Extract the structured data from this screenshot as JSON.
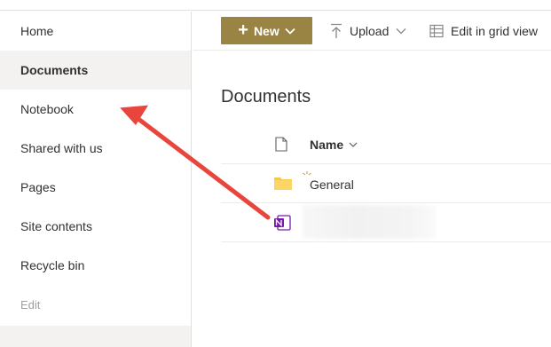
{
  "sidebar": {
    "items": [
      {
        "label": "Home"
      },
      {
        "label": "Documents"
      },
      {
        "label": "Notebook"
      },
      {
        "label": "Shared with us"
      },
      {
        "label": "Pages"
      },
      {
        "label": "Site contents"
      },
      {
        "label": "Recycle bin"
      },
      {
        "label": "Edit"
      }
    ],
    "selected": "Documents"
  },
  "toolbar": {
    "new_label": "New",
    "upload_label": "Upload",
    "grid_label": "Edit in grid view"
  },
  "main": {
    "title": "Documents",
    "columns": {
      "name": "Name"
    },
    "rows": [
      {
        "name": "General",
        "icon": "folder-icon"
      },
      {
        "name": "",
        "icon": "onenote-icon"
      }
    ]
  },
  "colors": {
    "accent": "#9a8444",
    "annotation_arrow": "#e8453c",
    "folder": "#f7c948",
    "onenote": "#7719aa"
  }
}
